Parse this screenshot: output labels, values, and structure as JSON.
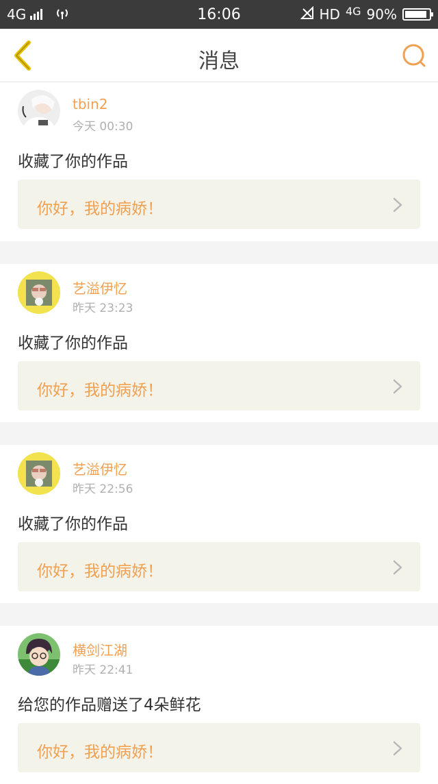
{
  "status_bar": {
    "network_left": "4G",
    "time": "16:06",
    "hd": "HD",
    "network_right": "4G",
    "battery_text": "90%",
    "battery_level": 0.9
  },
  "header": {
    "title": "消息",
    "back_icon": "chevron-left-icon",
    "search_icon": "search-icon"
  },
  "colors": {
    "accent": "#f0a050",
    "back_icon": "#e6c000",
    "status_bar_bg": "#3b3b3b"
  },
  "messages": [
    {
      "user": "tbin2",
      "time": "今天 00:30",
      "action": "收藏了你的作品",
      "work_title": "你好，我的病娇！",
      "avatar": "avatar-girl-white"
    },
    {
      "user": "艺溢伊忆",
      "time": "昨天 23:23",
      "action": "收藏了你的作品",
      "work_title": "你好，我的病娇！",
      "avatar": "avatar-yellow-photo"
    },
    {
      "user": "艺溢伊忆",
      "time": "昨天 22:56",
      "action": "收藏了你的作品",
      "work_title": "你好，我的病娇！",
      "avatar": "avatar-yellow-photo"
    },
    {
      "user": "横剑江湖",
      "time": "昨天 22:41",
      "action": "给您的作品赠送了4朵鲜花",
      "work_title": "你好，我的病娇！",
      "avatar": "avatar-anime-boy"
    }
  ]
}
